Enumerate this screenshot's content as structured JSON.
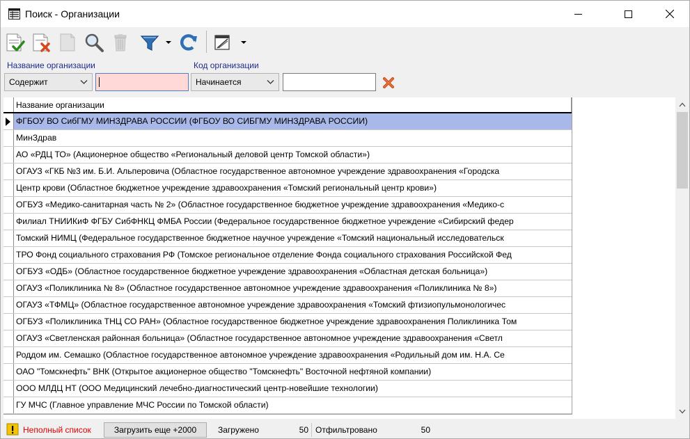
{
  "window": {
    "title": "Поиск - Организации"
  },
  "toolbar": {
    "buttons": [
      "select-icon",
      "cancel-icon",
      "blank-doc-icon",
      "search-icon",
      "delete-icon",
      "filter-icon",
      "refresh-icon",
      "edit-icon"
    ]
  },
  "filters": {
    "name_label": "Название организации",
    "name_mode": "Содержит",
    "name_value": "",
    "code_label": "Код организации",
    "code_mode": "Начинается",
    "code_value": ""
  },
  "grid": {
    "header": "Название организации",
    "rows": [
      "ФГБОУ ВО СибГМУ МИНЗДРАВА РОССИИ (ФГБОУ ВО СИБГМУ МИНЗДРАВА РОССИИ)",
      "МинЗдрав",
      "АО «РДЦ ТО» (Акционерное общество «Региональный деловой центр Томской области»)",
      "ОГАУЗ «ГКБ №3 им. Б.И. Альперовича (Областное государственное автономное учреждение здравоохранения «Городска",
      "Центр крови (Областное бюджетное учреждение здравоохранения «Томский региональный центр крови»)",
      "ОГБУЗ «Медико-санитарная часть № 2» (Областное государственное бюджетное учреждение здравоохранения «Медико-с",
      "Филиал ТНИИКиФ ФГБУ СибФНКЦ ФМБА России (Федеральное государственное бюджетное учреждение «Сибирский федер",
      "Томский НИМЦ (Федеральное государственное бюджетное научное учреждение «Томский национальный исследовательск",
      "ТРО Фонд социального страхования РФ (Томское региональное отделение Фонда социального страхования Российской Фед",
      "ОГБУЗ «ОДБ» (Областное государственное бюджетное учреждение здравоохранения «Областная детская больница»)",
      "ОГАУЗ «Поликлиника № 8» (Областное государственное автономное учреждение здравоохранения «Поликлиника № 8»)",
      "ОГАУЗ «ТФМЦ» (Областное государственное автономное учреждение здравоохранения «Томский фтизиопульмонологичес",
      "ОГБУЗ «Поликлиника ТНЦ СО РАН» (Областное государственное бюджетное учреждение здравоохранения Поликлиника Том",
      "ОГАУЗ «Светленская районная больница» (Областное государственное автономное учреждение здравоохранения «Светл",
      "Роддом им. Семашко (Областное государственное автономное  учреждение здравоохранения  «Родильный дом им. Н.А. Се",
      "ОАО \"Томскнефть\" ВНК (Открытое акционерное общество \"Томскнефть\" Восточной нефтяной компании)",
      "ООО МЛДЦ НТ (ООО Медицинский лечебно-диагностический центр-новейшие технологии)",
      "ГУ МЧС (Главное управление МЧС России по Томской области)"
    ],
    "selected_index": 0
  },
  "status": {
    "warning": "Неполный список",
    "load_more": "Загрузить еще +2000",
    "loaded_label": "Загружено",
    "loaded_value": "50",
    "filtered_label": "Отфильтровано",
    "filtered_value": "50"
  },
  "colors": {
    "selected_row": "#a8b8e8",
    "name_input_bg": "#ffd8d8",
    "label_blue": "#1e2a8c",
    "warning_red": "#e00000"
  }
}
